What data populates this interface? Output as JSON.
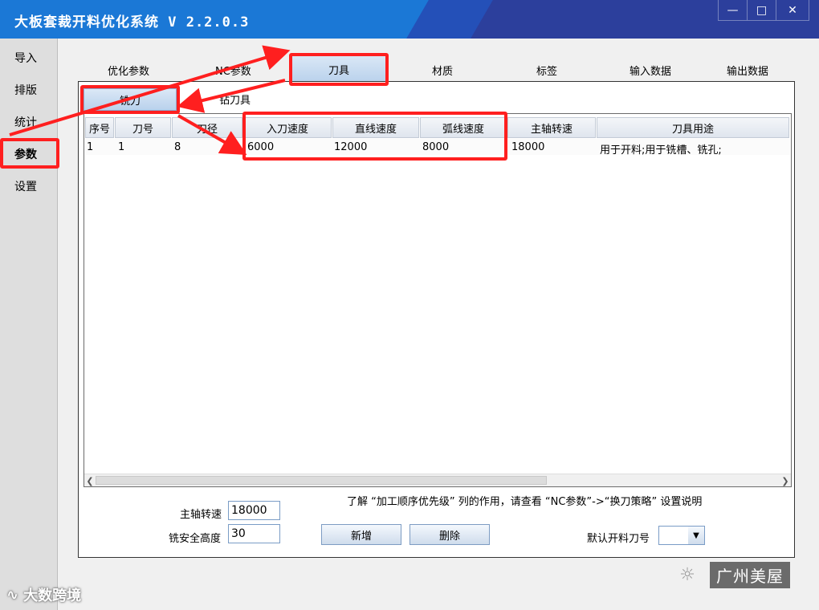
{
  "window": {
    "title": "大板套裁开料优化系统 V 2.2.0.3",
    "min_icon": "minimize-icon",
    "max_icon": "maximize-icon",
    "close_icon": "close-icon"
  },
  "sidebar": {
    "items": [
      {
        "label": "导入"
      },
      {
        "label": "排版"
      },
      {
        "label": "统计"
      },
      {
        "label": "参数"
      },
      {
        "label": "设置"
      }
    ],
    "active_index": 3
  },
  "tabs": {
    "items": [
      {
        "label": "优化参数"
      },
      {
        "label": "NC参数"
      },
      {
        "label": "刀具"
      },
      {
        "label": "材质"
      },
      {
        "label": "标签"
      },
      {
        "label": "输入数据"
      },
      {
        "label": "输出数据"
      }
    ],
    "active_index": 2
  },
  "subtabs": {
    "items": [
      {
        "label": "铣刀"
      },
      {
        "label": "钻刀具"
      }
    ],
    "active_index": 0
  },
  "grid": {
    "columns": [
      "序号",
      "刀号",
      "刀径",
      "入刀速度",
      "直线速度",
      "弧线速度",
      "主轴转速",
      "刀具用途"
    ],
    "rows": [
      [
        "1",
        "1",
        "8",
        "6000",
        "12000",
        "8000",
        "18000",
        "用于开料;用于铣槽、铣孔;"
      ]
    ]
  },
  "form": {
    "spindle_label": "主轴转速",
    "spindle_value": "18000",
    "safe_height_label": "铣安全高度",
    "safe_height_value": "30",
    "hint": "了解 “加工顺序优先级” 列的作用，请查看 “NC参数”->“换刀策略” 设置说明",
    "add_label": "新增",
    "delete_label": "删除",
    "default_tool_label": "默认开料刀号",
    "default_tool_value": ""
  },
  "watermarks": {
    "left": "大数跨境",
    "right": "广州美屋"
  },
  "colors": {
    "titlebar": "#1b78d6",
    "highlight": "#ff1f1f"
  }
}
